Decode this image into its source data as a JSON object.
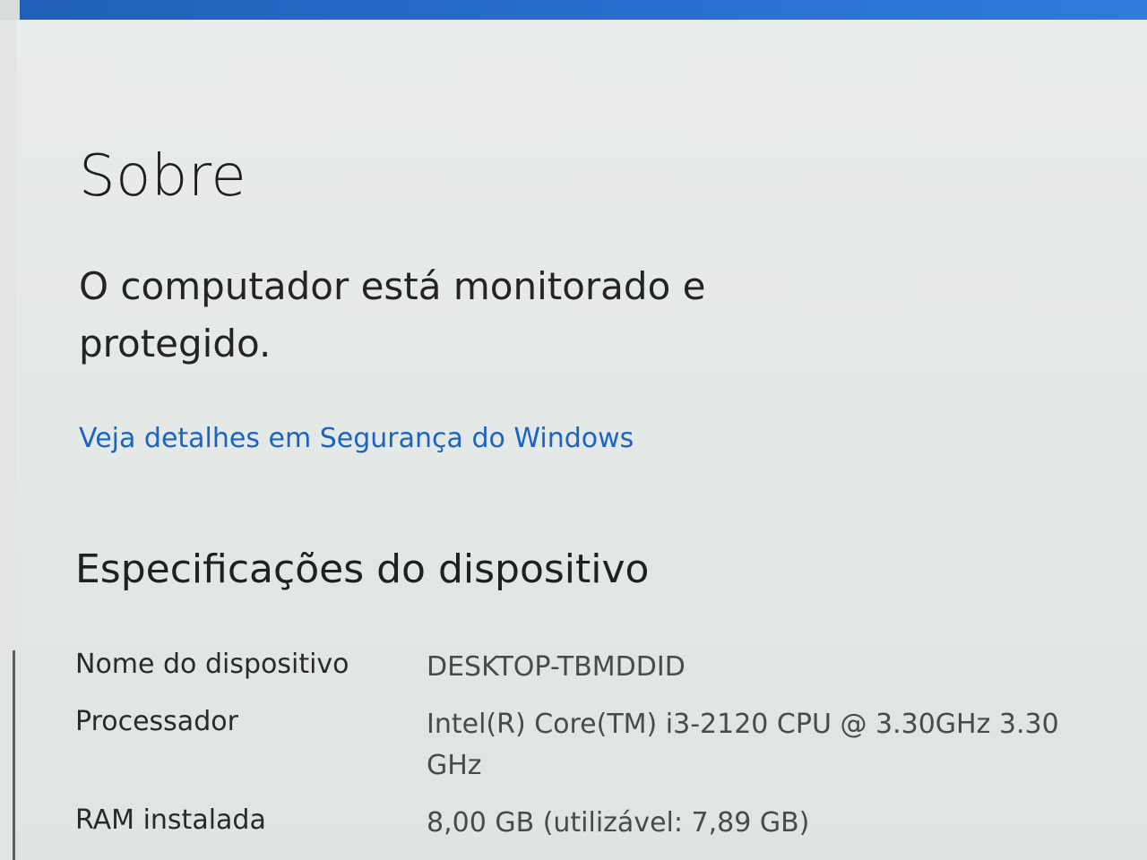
{
  "about": {
    "title": "Sobre",
    "protection_status": "O computador está monitorado e protegido.",
    "security_link": "Veja detalhes em Segurança do Windows"
  },
  "specs": {
    "heading": "Especificações do dispositivo",
    "rows": [
      {
        "label": "Nome do dispositivo",
        "value": "DESKTOP-TBMDDID"
      },
      {
        "label": "Processador",
        "value": "Intel(R) Core(TM) i3-2120 CPU @ 3.30GHz   3.30 GHz"
      },
      {
        "label": "RAM instalada",
        "value": "8,00 GB (utilizável: 7,89 GB)"
      }
    ]
  },
  "colors": {
    "link": "#1a64c4",
    "title_bar": "#2a6fd0"
  }
}
